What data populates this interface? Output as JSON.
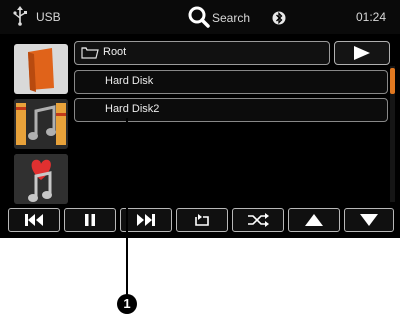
{
  "status_bar": {
    "source_label": "USB",
    "search_label": "Search",
    "clock": "01:24",
    "icons": [
      "usb-icon",
      "search-icon",
      "bluetooth-icon"
    ]
  },
  "browser": {
    "path": "Root",
    "items": [
      {
        "label": "Hard Disk"
      },
      {
        "label": "Hard Disk2"
      }
    ]
  },
  "controls": [
    "previous-track",
    "pause",
    "next-track",
    "repeat",
    "shuffle",
    "scroll-up",
    "scroll-down"
  ],
  "callout": {
    "number": "1"
  },
  "colors": {
    "accent": "#e07820",
    "screen_bg": "#000000",
    "border": "#9a9a9a"
  }
}
